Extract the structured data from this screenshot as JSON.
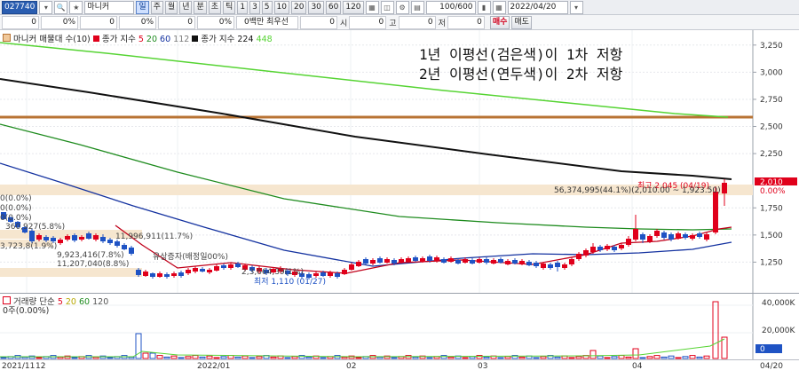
{
  "toolbar1": {
    "code": "027740",
    "stock_name": "마니커",
    "periods": [
      "일",
      "주",
      "월",
      "년",
      "분",
      "초",
      "틱"
    ],
    "selected_period": "일",
    "intervals": [
      "1",
      "3",
      "5",
      "10",
      "20",
      "30",
      "60",
      "120"
    ],
    "count": "100/600",
    "date": "2022/04/20"
  },
  "toolbar2": {
    "v1": "0",
    "p1": "0%",
    "v2": "0",
    "p2": "0%",
    "v3": "0",
    "p3": "0%",
    "price_label": "0백만 최우선",
    "v4": "0",
    "si_label": "시",
    "v5": "0",
    "go_label": "고",
    "v6": "0",
    "jeo_label": "저",
    "v7": "0",
    "buy": "매수",
    "sell": "매도"
  },
  "legend_main": {
    "item1": "마니커 매물대 수(10)",
    "item2_label": "종가 지수",
    "ma": [
      "5",
      "20",
      "60",
      "112"
    ],
    "item3_label": "종가 지수",
    "ma2": [
      "224",
      "448"
    ]
  },
  "annotation": {
    "line1": "1년 이평선(검은색)이 1차 저항",
    "line2": "2년 이평선(연두색)이 2차 저항"
  },
  "price_labels": {
    "high": "최고 2,045 (04/19)",
    "current_vol": "56,374,995(44.1%)(2,010.00 ~ 1,923.50)",
    "mid": "11,996,911(11.7%)",
    "left1": "0(0.0%)",
    "left2": "0(0.0%)",
    "left3": "0(0.0%)",
    "left4": "360,927(5.8%)",
    "left5": "3,723,8(1.9%)",
    "left6": "9,923,416(7.8%)",
    "left7": "11,207,040(8.8%)",
    "event": "유상증자(배정일00%)",
    "low": "최저 1,110 (01/27)",
    "row": "2,3,664,39(1%)"
  },
  "price_axis": {
    "ticks": [
      "3,250",
      "3,000",
      "2,750",
      "2,500",
      "2,250",
      "1,750",
      "1,500",
      "1,250"
    ],
    "current": "2,010",
    "current_pct": "0.00%"
  },
  "volume": {
    "legend_label": "거래량",
    "legend_ma_label": "단순",
    "ma": [
      "5",
      "20",
      "60",
      "120"
    ],
    "left": "0주(0.00%)",
    "ticks": [
      "40,000K",
      "20,000K",
      "0"
    ]
  },
  "xaxis": {
    "labels": [
      "2021/11",
      "12",
      "2022/01",
      "02",
      "03",
      "04",
      "04/20"
    ]
  },
  "colors": {
    "up": "#e0001b",
    "down": "#1f53c4",
    "ma5": "#e0001b",
    "ma20": "#1e8b1e",
    "ma60": "#1432a0",
    "ma112": "#7a7a7a",
    "ma224": "#111111",
    "ma448": "#56d433",
    "hline": "#b87333"
  }
}
